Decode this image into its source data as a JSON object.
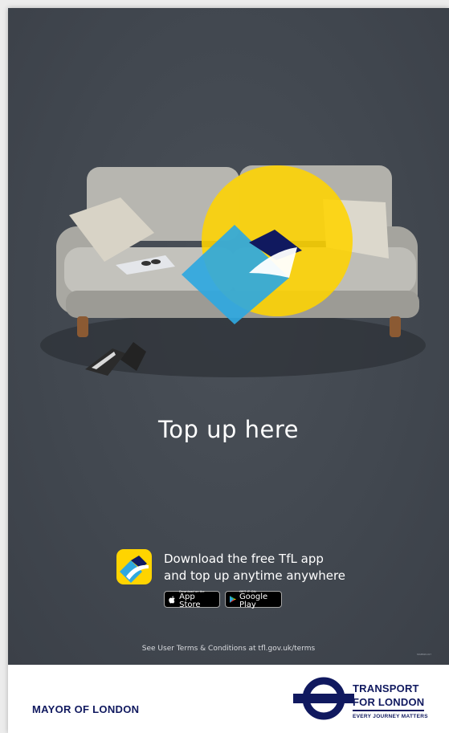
{
  "headline": "Top up here",
  "app_promo": {
    "line1": "Download the free TfL app",
    "line2": "and top up anytime anywhere",
    "app_icon": "tfl-app-icon"
  },
  "badges": {
    "app_store": {
      "small": "Download on the",
      "big": "App Store",
      "icon": "apple-icon"
    },
    "google_play": {
      "small": "GET IT ON",
      "big": "Google Play",
      "icon": "play-icon"
    }
  },
  "terms": "See User Terms & Conditions at tfl.gov.uk/terms",
  "ref_code": "MGB626-017",
  "footer": {
    "mayor": "MAYOR OF LONDON",
    "tfl_line1": "TRANSPORT",
    "tfl_line2": "FOR LONDON",
    "tfl_line3": "EVERY JOURNEY MATTERS"
  },
  "colors": {
    "background": "#41474f",
    "tfl_blue": "#10195f",
    "yellow": "#ffd400",
    "cyan": "#2fa8e0"
  }
}
